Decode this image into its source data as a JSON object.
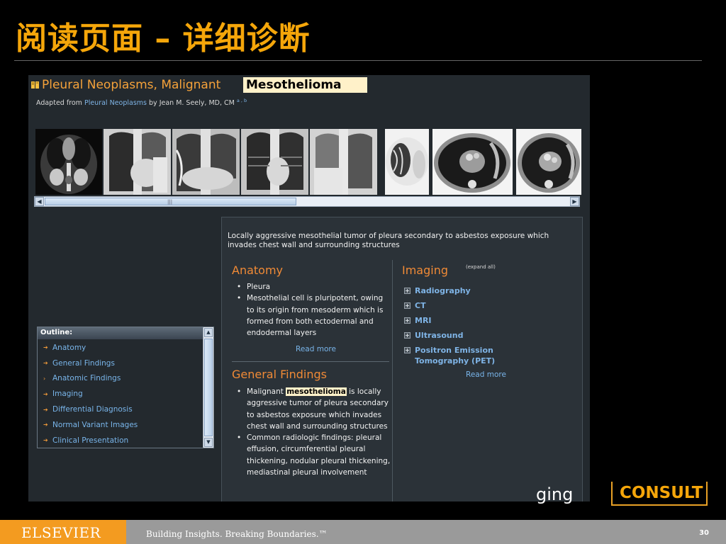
{
  "slide": {
    "title": "阅读页面 – 详细诊断",
    "page_number": "30"
  },
  "header": {
    "topic_title": "Pleural Neoplasms, Malignant",
    "term": "Mesothelioma",
    "adapted_prefix": "Adapted from ",
    "adapted_link": "Pleural Neoplasms",
    "adapted_by": " by Jean M. Seely, MD, CM ",
    "adapted_refs": "a , b"
  },
  "thumbnails": [
    {
      "name": "ct-coronal-abdomen"
    },
    {
      "name": "chest-xray-pa-1"
    },
    {
      "name": "chest-xray-pa-2"
    },
    {
      "name": "chest-xray-pa-3"
    },
    {
      "name": "chest-xray-pa-4"
    },
    {
      "name": "ct-lung-window"
    },
    {
      "name": "ct-mediastinal-1"
    },
    {
      "name": "ct-mediastinal-2"
    }
  ],
  "outline": {
    "title": "Outline:",
    "items": [
      {
        "label": "Anatomy"
      },
      {
        "label": "General Findings"
      },
      {
        "label": "Anatomic Findings"
      },
      {
        "label": "Imaging"
      },
      {
        "label": "Differential Diagnosis"
      },
      {
        "label": "Normal Variant Images"
      },
      {
        "label": "Clinical Presentation"
      }
    ]
  },
  "content": {
    "summary": "Locally aggressive mesothelial tumor of pleura secondary to asbestos exposure which invades chest wall and surrounding structures",
    "anatomy": {
      "title": "Anatomy",
      "bullets": [
        "Pleura",
        "Mesothelial cell is pluripotent, owing to its origin from mesoderm which is formed from both ectodermal and endodermal layers"
      ],
      "read_more": "Read more"
    },
    "general_findings": {
      "title": "General Findings",
      "bullet1_pre": "Malignant ",
      "bullet1_hl": "mesothelioma",
      "bullet1_post": " is locally aggressive tumor of pleura secondary to asbestos exposure which invades chest wall and surrounding structures",
      "bullet2": "Common radiologic findings: pleural effusion, circumferential pleural thickening, nodular pleural thickening, mediastinal pleural involvement"
    },
    "imaging": {
      "title": "Imaging",
      "expand_all": "(expand all)",
      "items": [
        {
          "label": "Radiography"
        },
        {
          "label": "CT"
        },
        {
          "label": "MRI"
        },
        {
          "label": "Ultrasound"
        },
        {
          "label": "Positron Emission Tomography (PET)"
        }
      ],
      "read_more": "Read more"
    }
  },
  "brand": {
    "partial": "ging",
    "consult": "CONSULT"
  },
  "footer": {
    "logo": "ELSEVIER",
    "tagline": "Building Insights. Breaking Boundaries.™"
  },
  "colors": {
    "title_orange": "#f5a60a",
    "section_orange": "#f08a36",
    "link_blue": "#79b5ea",
    "footer_orange": "#f39b20",
    "footer_gray": "#9a9a9a"
  }
}
